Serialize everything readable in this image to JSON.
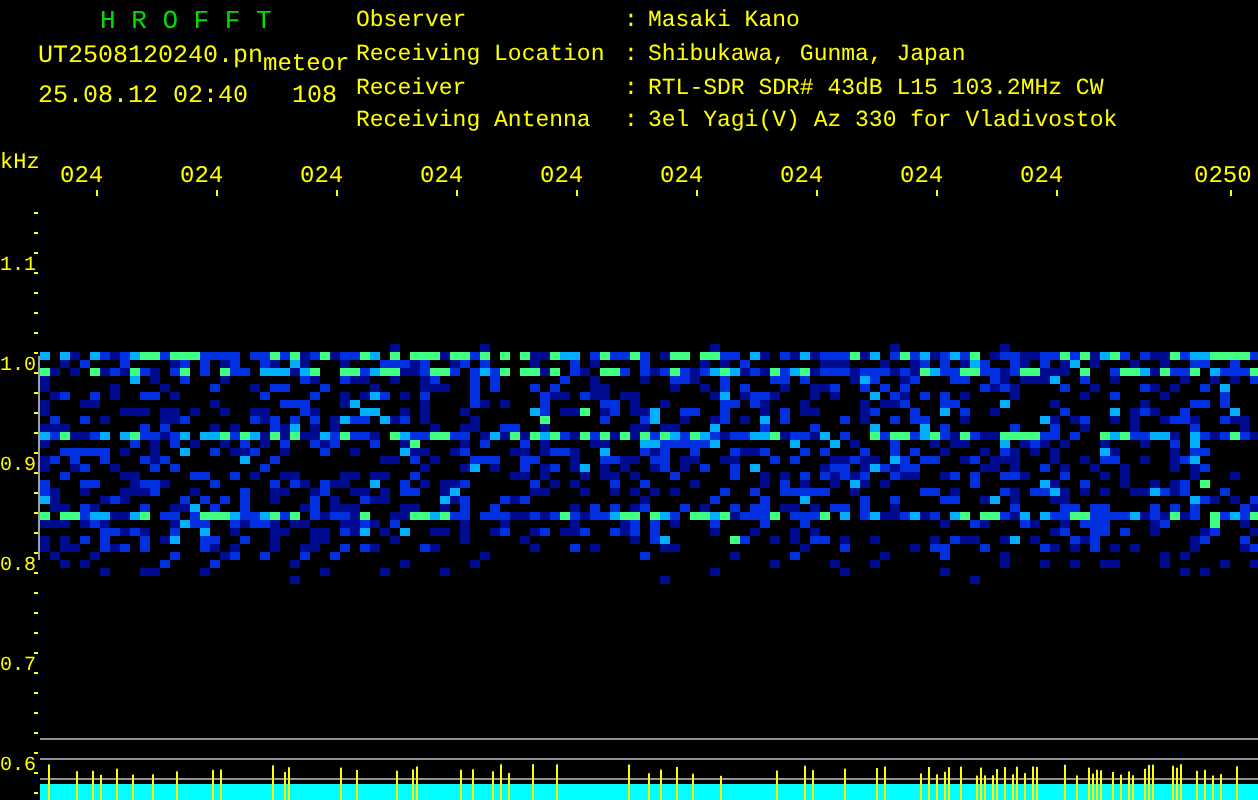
{
  "header": {
    "program": "H R O F F T",
    "filename": "UT2508120240.pn",
    "tag": "meteor",
    "timestamp": "25.08.12 02:40",
    "count": "108"
  },
  "info": [
    {
      "label": "Observer",
      "separator": ":",
      "value": "Masaki Kano"
    },
    {
      "label": "Receiving Location",
      "separator": ":",
      "value": "Shibukawa, Gunma, Japan"
    },
    {
      "label": "Receiver",
      "separator": ":",
      "value": "RTL-SDR SDR# 43dB L15 103.2MHz CW"
    },
    {
      "label": "Receiving Antenna",
      "separator": ":",
      "value": "3el Yagi(V) Az 330 for Vladivostok"
    }
  ],
  "plot": {
    "y_unit": "kHz",
    "y_labels": [
      "1.1",
      "1.0",
      "0.9",
      "0.8",
      "0.7",
      "0.6"
    ],
    "x_labels": [
      "024",
      "024",
      "024",
      "024",
      "024",
      "024",
      "024",
      "024",
      "024",
      "0250"
    ]
  }
}
